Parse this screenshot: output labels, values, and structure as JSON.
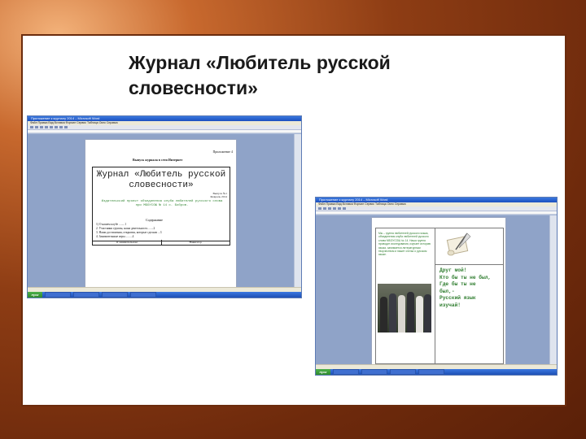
{
  "slide": {
    "title": "Журнал «Любитель русской словесности»",
    "colors": {
      "background": "#8e3d14",
      "frame_border": "#6b2c0d",
      "word_green": "#2e7d2e"
    }
  },
  "screenshot_left": {
    "window_title": "Приложение к журналу 2014 – Microsoft Word",
    "menu": "Файл  Правка  Вид  Вставка  Формат  Сервис  Таблица  Окно  Справка",
    "start_label": "пуск",
    "document": {
      "appendix_label": "Приложение 4",
      "issue_heading": "Выпуск журнала в сети Интернет",
      "magazine_title": "Журнал «Любитель русской словесности»",
      "meta_lines": [
        "Выпуск №1",
        "Февраль 2014"
      ],
      "description": "Издательский проект объединения клуба любителей русского слова при МБОУСОШ № 14 с. Бобров.",
      "contents_heading": "Содержание",
      "toc": [
        "1) О нашем клубе ........1",
        "2. Участники группы, наша деятельность .......2",
        "3. Наши достижения, открытия, которые сделали ...3",
        "4. Занимательные игры .........4"
      ],
      "footer_cells": [
        "О занимательном",
        "Навигатор"
      ]
    }
  },
  "screenshot_right": {
    "window_title": "Приложение к журналу 2014 – Microsoft Word",
    "menu": "Файл  Правка  Вид  Вставка  Формат  Сервис  Таблица  Окно  Справка",
    "start_label": "пуск",
    "document": {
      "intro_text": "Мы – группа любителей русского языка, объединения клуба любителей русского слова МБОУСОШ № 14. Наша группа проводит исследования, изучает историю языка, занимается литературным творчеством и пишет статьи о русском языке.",
      "poem": "Друг мой!\nКто бы ты не был,\nГде бы ты не\nбыл,-\nРусский язык\nизучай!"
    }
  }
}
